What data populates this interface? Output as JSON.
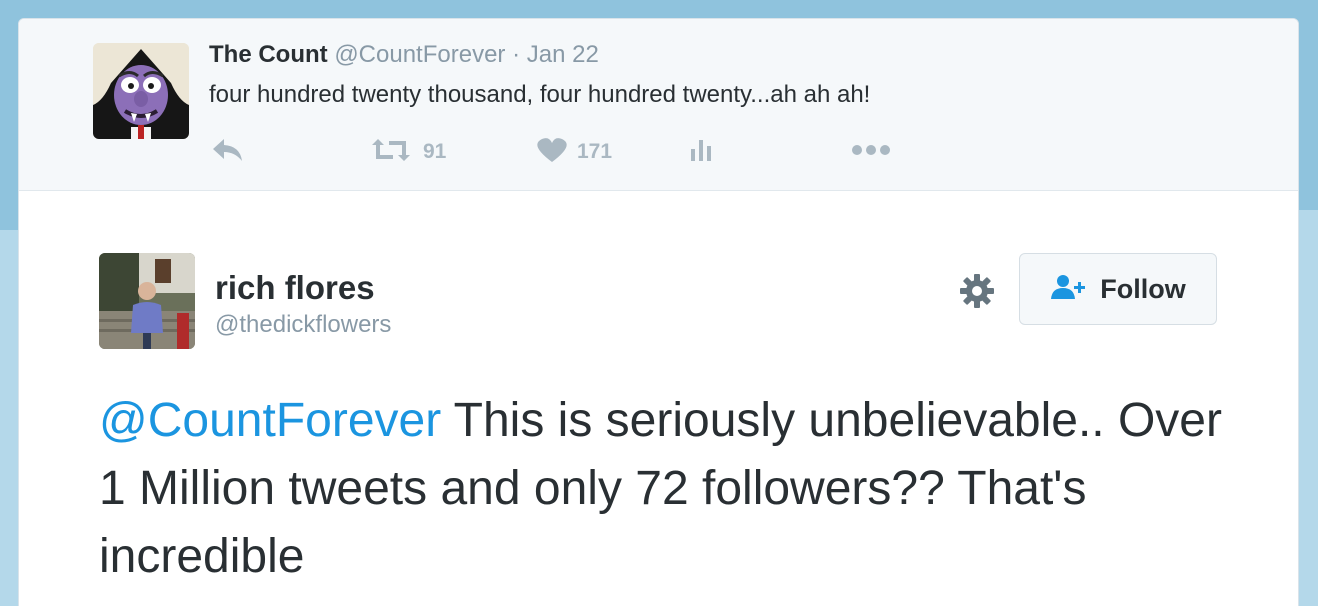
{
  "parent_tweet": {
    "name": "The Count",
    "handle": "@CountForever",
    "separator": " · ",
    "date": "Jan 22",
    "text": "four hundred twenty thousand, four hundred twenty...ah ah ah!",
    "retweets": "91",
    "likes": "171"
  },
  "main_tweet": {
    "name": "rich flores",
    "handle": "@thedickflowers",
    "follow_label": "Follow",
    "mention": "@CountForever",
    "text": " This is seriously unbelievable.. Over 1 Million tweets and only 72 followers?? That's incredible"
  },
  "icons": {
    "reply": "reply-icon",
    "retweet": "retweet-icon",
    "like": "heart-icon",
    "analytics": "analytics-icon",
    "more": "more-icon",
    "settings": "gear-icon",
    "follow": "add-user-icon"
  },
  "colors": {
    "link": "#1b95e0",
    "text": "#292f33",
    "muted": "#8899a6",
    "action": "#aab8c2",
    "background": "#8fc3dd"
  }
}
